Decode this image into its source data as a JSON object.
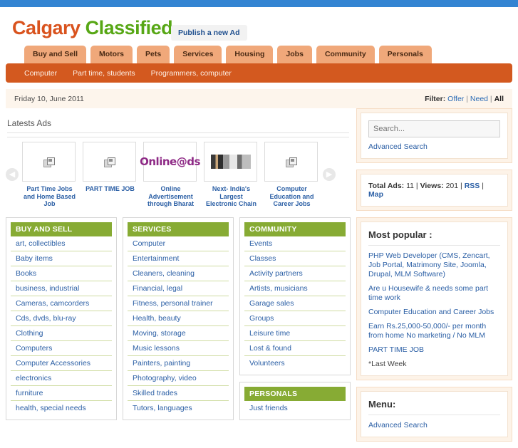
{
  "browser": {
    "accent_color": "#3384d2"
  },
  "header": {
    "logo_part1": "Calgary",
    "logo_part2": "Classified",
    "publish_label": "Publish a new Ad"
  },
  "nav": {
    "tabs": [
      {
        "label": "Buy and Sell"
      },
      {
        "label": "Motors"
      },
      {
        "label": "Pets"
      },
      {
        "label": "Services"
      },
      {
        "label": "Housing"
      },
      {
        "label": "Jobs"
      },
      {
        "label": "Community"
      },
      {
        "label": "Personals"
      }
    ]
  },
  "subnav": {
    "items": [
      {
        "label": "Computer"
      },
      {
        "label": "Part time, students"
      },
      {
        "label": "Programmers, computer"
      }
    ]
  },
  "datebar": {
    "date": "Friday 10, June 2011",
    "filter_label": "Filter:",
    "filter_offer": "Offer",
    "filter_need": "Need",
    "filter_all": "All",
    "sep": "|"
  },
  "latest": {
    "title": "Latests Ads",
    "prev_icon": "chevron-left-icon",
    "next_icon": "chevron-right-icon",
    "cards": [
      {
        "label": "Part Time Jobs and Home Based Job",
        "image": "broken-image-icon"
      },
      {
        "label": "PART TIME JOB",
        "image": "broken-image-icon"
      },
      {
        "label": "Online Advertisement through Bharat",
        "image": "online-ads-logo"
      },
      {
        "label": "Next- India's Largest Electronic Chain",
        "image": "electronics-photo"
      },
      {
        "label": "Computer Education and Career Jobs",
        "image": "broken-image-icon"
      }
    ]
  },
  "categories": [
    {
      "title": "BUY AND SELL",
      "items": [
        "art, collectibles",
        "Baby items",
        "Books",
        "business, industrial",
        "Cameras, camcorders",
        "Cds, dvds, blu-ray",
        "Clothing",
        "Computers",
        "Computer Accessories",
        "electronics",
        "furniture",
        "health, special needs"
      ]
    },
    {
      "title": "SERVICES",
      "items": [
        "Computer",
        "Entertainment",
        "Cleaners, cleaning",
        "Financial, legal",
        "Fitness, personal trainer",
        "Health, beauty",
        "Moving, storage",
        "Music lessons",
        "Painters, painting",
        "Photography, video",
        "Skilled trades",
        "Tutors, languages"
      ]
    },
    {
      "title": "COMMUNITY",
      "items": [
        "Events",
        "Classes",
        "Activity partners",
        "Artists, musicians",
        "Garage sales",
        "Groups",
        "Leisure time",
        "Lost & found",
        "Volunteers"
      ]
    }
  ],
  "personals": {
    "title": "PERSONALS",
    "items": [
      "Just friends"
    ]
  },
  "sidebar": {
    "search_placeholder": "Search...",
    "advanced_search": "Advanced Search",
    "stats": {
      "total_ads_label": "Total Ads:",
      "total_ads_value": "11",
      "views_label": "Views:",
      "views_value": "201",
      "rss": "RSS",
      "map": "Map",
      "sep": "|"
    },
    "popular": {
      "title": "Most popular :",
      "items": [
        "PHP Web Developer (CMS, Zencart, Job Portal, Matrimony Site, Joomla, Drupal, MLM Software)",
        "Are u Housewife & needs some part time work",
        "Computer Education and Career Jobs",
        "Earn Rs.25,000-50,000/- per month from home No marketing / No MLM",
        "PART TIME JOB"
      ],
      "footnote": "*Last Week"
    },
    "menu": {
      "title": "Menu:",
      "items": [
        "Advanced Search"
      ]
    }
  }
}
